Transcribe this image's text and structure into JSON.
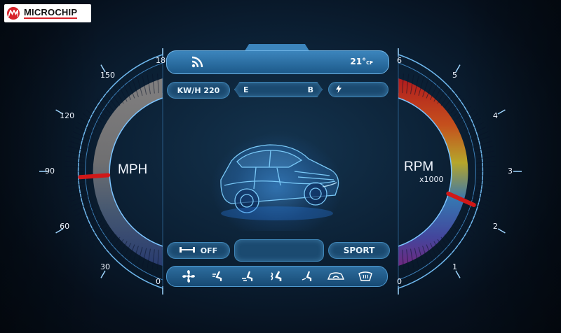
{
  "brand": {
    "name": "MICROCHIP",
    "brand_color": "#d8232a"
  },
  "speedometer": {
    "unit_label": "MPH",
    "tick_labels": [
      "0",
      "30",
      "60",
      "90",
      "120",
      "150",
      "180"
    ],
    "value": 86,
    "max": 180,
    "needle_color": "#d01818"
  },
  "tachometer": {
    "unit_label": "RPM",
    "unit_sub": "x1000",
    "tick_labels": [
      "0",
      "1",
      "2",
      "3",
      "4",
      "5",
      "6"
    ],
    "value": 2.2,
    "max": 6,
    "needle_color": "#d01818"
  },
  "status_bar": {
    "wifi_icon": "wifi-icon",
    "temperature": "21°",
    "temperature_unit": "CF"
  },
  "energy": {
    "kwh_label": "KW/H 220",
    "range_start": "E",
    "range_end": "B",
    "charge_icon": "bolt-icon"
  },
  "controls": {
    "seat_toggle_label": "OFF",
    "mode_label": "SPORT"
  },
  "climate_icons": [
    "fan-icon",
    "seat-airflow-face-icon",
    "seat-airflow-feet-icon",
    "seat-airflow-heat-icon",
    "seat-airflow-recline-icon",
    "recirculation-icon",
    "defrost-icon"
  ],
  "vehicle": {
    "image": "car-wireframe-icon"
  }
}
